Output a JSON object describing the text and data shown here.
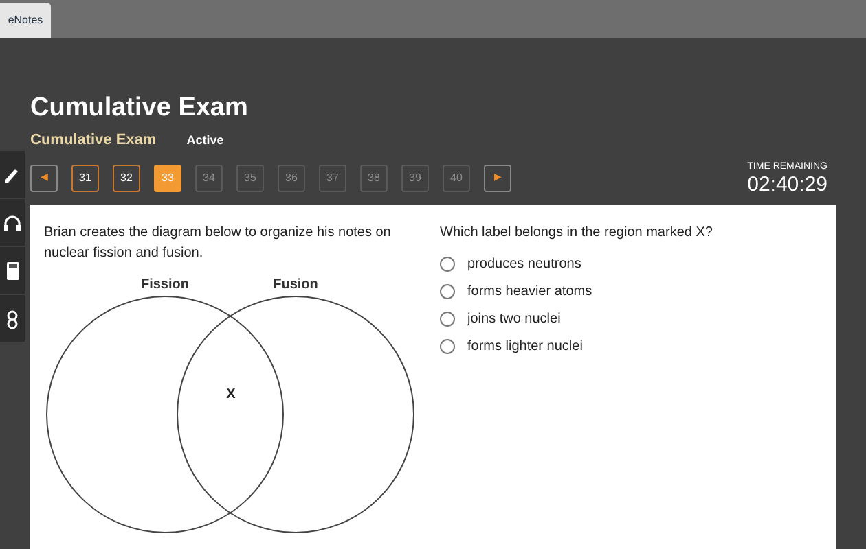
{
  "browser_tab": {
    "label": "eNotes"
  },
  "header": {
    "title": "Cumulative Exam",
    "subtitle": "Cumulative Exam",
    "status": "Active"
  },
  "pagination": {
    "prev": "◀",
    "next": "▶",
    "pages": [
      {
        "label": "31",
        "selected": false,
        "disabled": false
      },
      {
        "label": "32",
        "selected": false,
        "disabled": false
      },
      {
        "label": "33",
        "selected": true,
        "disabled": false
      },
      {
        "label": "34",
        "selected": false,
        "disabled": true
      },
      {
        "label": "35",
        "selected": false,
        "disabled": true
      },
      {
        "label": "36",
        "selected": false,
        "disabled": true
      },
      {
        "label": "37",
        "selected": false,
        "disabled": true
      },
      {
        "label": "38",
        "selected": false,
        "disabled": true
      },
      {
        "label": "39",
        "selected": false,
        "disabled": true
      },
      {
        "label": "40",
        "selected": false,
        "disabled": true
      }
    ]
  },
  "timer": {
    "label": "TIME REMAINING",
    "value": "02:40:29"
  },
  "tools": [
    {
      "kind": "pencil"
    },
    {
      "kind": "headphones"
    },
    {
      "kind": "calculator"
    },
    {
      "kind": "reference"
    }
  ],
  "question": {
    "stem": "Brian creates the diagram below to organize his notes on nuclear fission and fusion.",
    "diagram": {
      "left_label": "Fission",
      "right_label": "Fusion",
      "overlap_label": "X"
    },
    "prompt": "Which label belongs in the region marked X?",
    "options": [
      {
        "label": "produces neutrons",
        "selected": false
      },
      {
        "label": "forms heavier atoms",
        "selected": false
      },
      {
        "label": "joins two nuclei",
        "selected": false
      },
      {
        "label": "forms lighter nuclei",
        "selected": false
      }
    ]
  }
}
